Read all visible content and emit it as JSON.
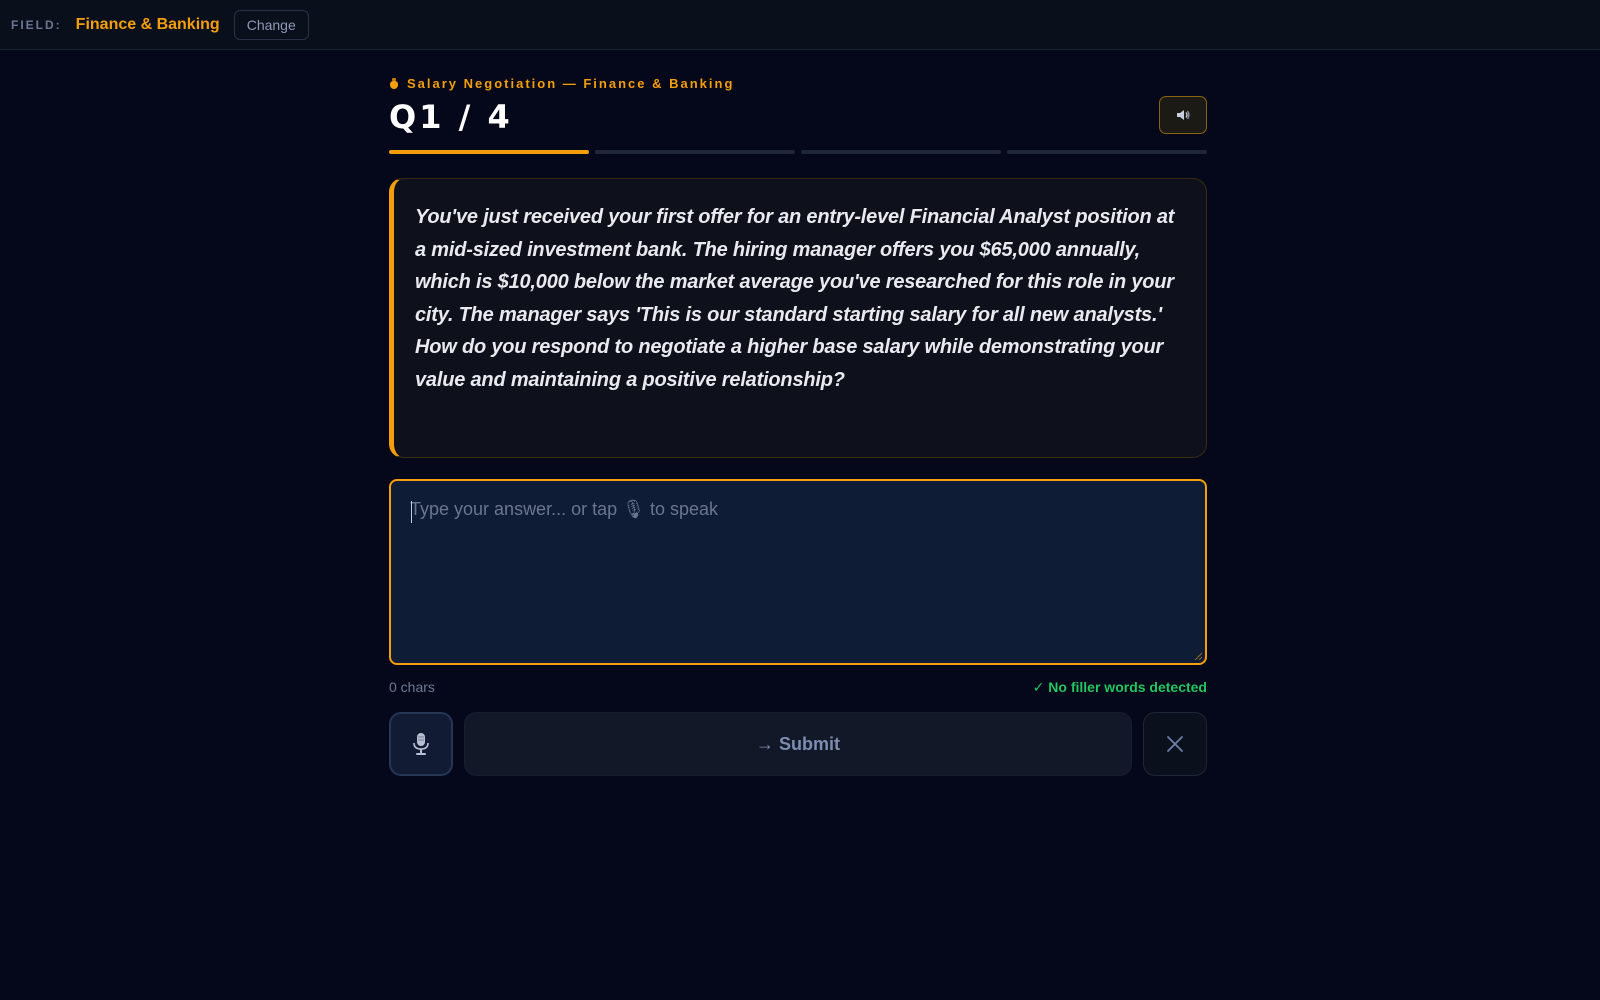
{
  "topbar": {
    "field_label": "FIELD:",
    "field_value": "Finance & Banking",
    "change_label": "Change"
  },
  "session": {
    "eyebrow": "Salary Negotiation — Finance & Banking",
    "question_counter": "Q1 / 4",
    "current": 1,
    "total": 4
  },
  "question": {
    "text": "You've just received your first offer for an entry-level Financial Analyst position at a mid-sized investment bank. The hiring manager offers you $65,000 annually, which is $10,000 below the market average you've researched for this role in your city. The manager says 'This is our standard starting salary for all new analysts.' How do you respond to negotiate a higher base salary while demonstrating your value and maintaining a positive relationship?"
  },
  "answer": {
    "value": "",
    "placeholder": "Type your answer... or tap 🎙 to speak"
  },
  "meta": {
    "char_count": "0 chars",
    "filler_status": "✓ No filler words detected"
  },
  "actions": {
    "submit_label": "→ Submit"
  },
  "colors": {
    "accent": "#f59e0b",
    "background": "#05081a",
    "success": "#22c55e"
  },
  "icons": {
    "eyebrow": "money-bag-icon",
    "speaker": "speaker-icon",
    "mic": "microphone-icon",
    "cancel": "close-icon"
  }
}
